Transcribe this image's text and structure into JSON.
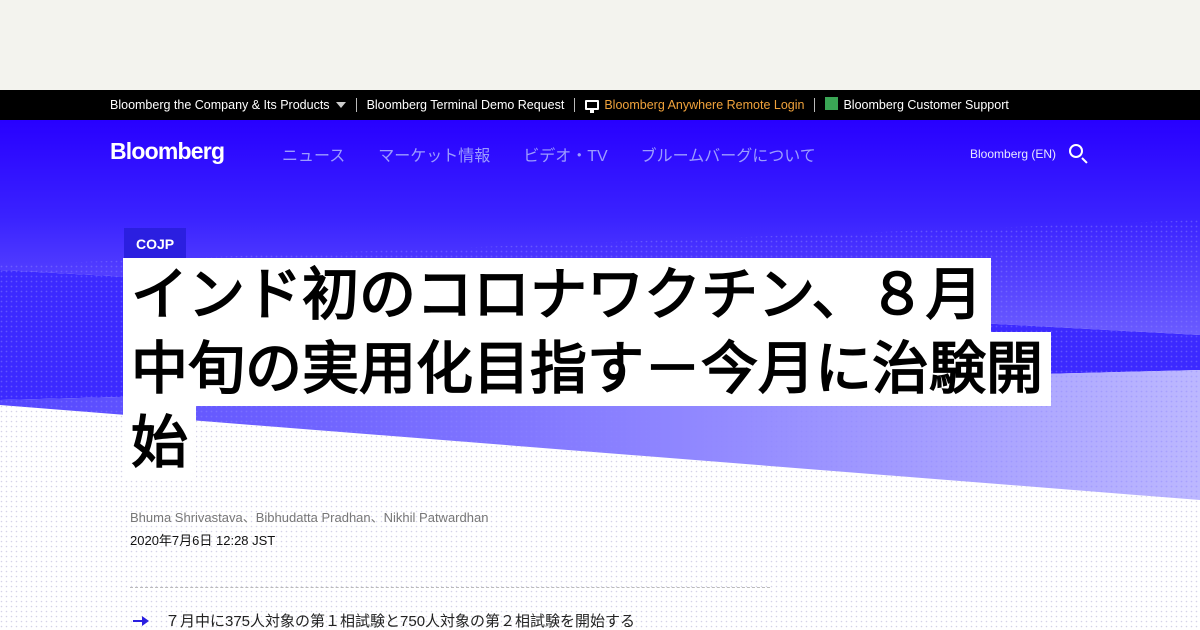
{
  "topbar": {
    "links": [
      "Bloomberg the Company & Its Products",
      "Bloomberg Terminal Demo Request",
      "Bloomberg Anywhere Remote Login",
      "Bloomberg Customer Support"
    ]
  },
  "nav": {
    "logo": "Bloomberg",
    "links": [
      "ニュース",
      "マーケット情報",
      "ビデオ・TV",
      "ブルームバーグについて"
    ],
    "edition": "Bloomberg (EN)"
  },
  "article": {
    "kicker": "COJP",
    "headline_lines": [
      "インド初のコロナワクチン、８月",
      "中旬の実用化目指す－今月に治験開",
      "始"
    ],
    "byline": "Bhuma Shrivastava、Bibhudatta Pradhan、Nikhil Patwardhan",
    "date": "2020年7月6日 12:28 JST",
    "summary": "７月中に375人対象の第１相試験と750人対象の第２相試験を開始する"
  },
  "colors": {
    "brand_blue": "#2b1fe0",
    "hero_blue": "#2800ff",
    "topbar_bg": "#000000",
    "orange_link": "#f0a23b"
  }
}
